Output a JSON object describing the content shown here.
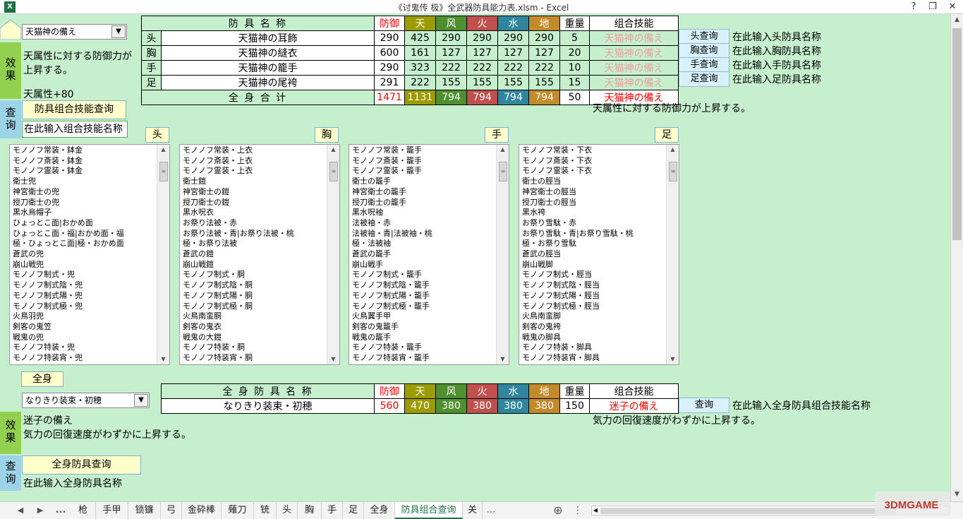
{
  "window": {
    "title": "《讨鬼传 极》全武器防具能力表.xlsm - Excel",
    "app_icon": "X",
    "help": "?",
    "restore": "❐",
    "close": "✕"
  },
  "top": {
    "combo_value": "天猫神の備え",
    "effect_label": "效\n果",
    "effect_text": "天属性に対する防御力が上昇する。",
    "effect_stat": "天属性+80",
    "query_label": "查\n询",
    "query_button": "防具组合技能查询",
    "query_input": "在此输入组合技能名称",
    "table": {
      "headers": [
        "防 具 名 称",
        "防御",
        "天",
        "风",
        "火",
        "水",
        "地",
        "重量",
        "组合技能"
      ],
      "rows": [
        {
          "part": "头",
          "name": "天猫神の耳飾",
          "def": "290",
          "ten": "425",
          "kaze": "290",
          "hi": "290",
          "mizu": "290",
          "chi": "290",
          "weight": "5",
          "skill": "天猫神の備え",
          "button": "头查询",
          "hint": "在此输入头防具名称"
        },
        {
          "part": "胸",
          "name": "天猫神の縫衣",
          "def": "600",
          "ten": "161",
          "kaze": "127",
          "hi": "127",
          "mizu": "127",
          "chi": "127",
          "weight": "20",
          "skill": "天猫神の備え",
          "button": "胸查询",
          "hint": "在此输入胸防具名称"
        },
        {
          "part": "手",
          "name": "天猫神の籠手",
          "def": "290",
          "ten": "323",
          "kaze": "222",
          "hi": "222",
          "mizu": "222",
          "chi": "222",
          "weight": "10",
          "skill": "天猫神の備え",
          "button": "手查询",
          "hint": "在此输入手防具名称"
        },
        {
          "part": "足",
          "name": "天猫神の尾袴",
          "def": "291",
          "ten": "222",
          "kaze": "155",
          "hi": "155",
          "mizu": "155",
          "chi": "155",
          "weight": "15",
          "skill": "天猫神の備え",
          "button": "足查询",
          "hint": "在此输入足防具名称"
        }
      ],
      "total": {
        "label": "全 身 合 计",
        "def": "1471",
        "ten": "1131",
        "kaze": "794",
        "hi": "794",
        "mizu": "794",
        "chi": "794",
        "weight": "50",
        "skill": "天猫神の備え"
      },
      "desc": "天属性に対する防御力が上昇する。"
    }
  },
  "lists": [
    {
      "label": "头",
      "items": [
        "モノノフ常装・鉢金",
        "モノノフ斎装・鉢金",
        "モノノフ霊装・鉢金",
        "衛士兜",
        "神宮衛士の兜",
        "授刀衛士の兜",
        "黒水烏帽子",
        "ひょっとこ面|おかめ面",
        "ひょっとこ面・福|おかめ面・福",
        "極・ひょっとこ面|極・おかめ面",
        "蒼武の兜",
        "崩山戦兜",
        "モノノフ制式・兜",
        "モノノフ制式陰・兜",
        "モノノフ制式陽・兜",
        "モノノフ制式極・兜",
        "火鳥羽兜",
        "剣客の鬼笠",
        "戦鬼の兜",
        "モノノフ特装・兜",
        "モノノフ特装宵・兜"
      ]
    },
    {
      "label": "胸",
      "items": [
        "モノノフ常装・上衣",
        "モノノフ斎装・上衣",
        "モノノフ霊装・上衣",
        "衛士鎧",
        "神宮衛士の鎧",
        "授刀衛士の鎧",
        "黒水呪衣",
        "お祭り法被・赤",
        "お祭り法被・青|お祭り法被・桃",
        "極・お祭り法被",
        "蒼武の鎧",
        "崩山戦鎧",
        "モノノフ制式・胴",
        "モノノフ制式陰・胴",
        "モノノフ制式陽・胴",
        "モノノフ制式極・胴",
        "火鳥南蛮胴",
        "剣客の鬼衣",
        "戦鬼の大鎧",
        "モノノフ特装・胴",
        "モノノフ特装宵・胴"
      ]
    },
    {
      "label": "手",
      "items": [
        "モノノフ常装・籠手",
        "モノノフ斎装・籠手",
        "モノノフ霊装・籠手",
        "衛士の籠手",
        "神宮衛士の籠手",
        "授刀衛士の籠手",
        "黒水呪袖",
        "法被袖・赤",
        "法被袖・青|法被袖・桃",
        "極・法被袖",
        "蒼武の籠手",
        "崩山戦手",
        "モノノフ制式・籠手",
        "モノノフ制式陰・籠手",
        "モノノフ制式陽・籠手",
        "モノノフ制式極・籠手",
        "火鳥翼手甲",
        "剣客の鬼籠手",
        "戦鬼の籠手",
        "モノノフ特装・籠手",
        "モノノフ特装宵・籠手"
      ]
    },
    {
      "label": "足",
      "items": [
        "モノノフ常装・下衣",
        "モノノフ斎装・下衣",
        "モノノフ霊装・下衣",
        "衛士の脛当",
        "神宮衛士の脛当",
        "授刀衛士の脛当",
        "黒水袴",
        "お祭り雪駄・赤",
        "お祭り雪駄・青|お祭り雪駄・桃",
        "極・お祭り雪駄",
        "蒼武の脛当",
        "崩山戦脚",
        "モノノフ制式・脛当",
        "モノノフ制式陰・脛当",
        "モノノフ制式陽・脛当",
        "モノノフ制式極・脛当",
        "火鳥南蛮脚",
        "剣客の鬼袴",
        "戦鬼の脚具",
        "モノノフ特装・脚具",
        "モノノフ特装宵・脚具"
      ]
    }
  ],
  "full": {
    "label": "全身",
    "combo_value": "なりきり装束・初穂",
    "effect_label": "效\n果",
    "effect_line1": "迷子の備え",
    "effect_line2": "気力の回復速度がわずかに上昇する。",
    "query_label": "查\n询",
    "query_button": "全身防具查询",
    "query_input": "在此输入全身防具名称",
    "table": {
      "headers": [
        "全 身 防 具 名 称",
        "防御",
        "天",
        "风",
        "火",
        "水",
        "地",
        "重量",
        "组合技能"
      ],
      "row": {
        "name": "なりきり装束・初穂",
        "def": "560",
        "ten": "470",
        "kaze": "380",
        "hi": "380",
        "mizu": "380",
        "chi": "380",
        "weight": "150",
        "skill": "迷子の備え"
      },
      "button": "查询",
      "hint": "在此输入全身防具组合技能名称",
      "desc": "気力の回復速度がわずかに上昇する。"
    }
  },
  "tabs": {
    "nav_prev": "◀",
    "nav_next": "▶",
    "more_left": "...",
    "items": [
      "枪",
      "手甲",
      "锁镰",
      "弓",
      "金砕棒",
      "薙刀",
      "铳",
      "头",
      "胸",
      "手",
      "足",
      "全身",
      "防具组合查询",
      "关"
    ],
    "active_index": 12,
    "more_right": "...",
    "add": "⊕",
    "options": "⋮"
  },
  "logo_text": "3DMGAME"
}
